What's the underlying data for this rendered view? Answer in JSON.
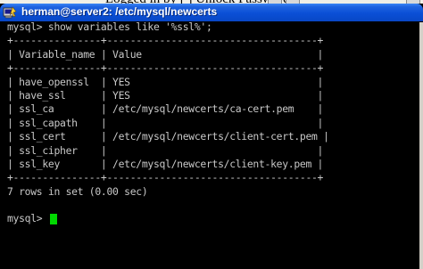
{
  "window": {
    "title": "herman@server2: /etc/mysql/newcerts"
  },
  "top_strip": {
    "partial_text": "Logged in by  [  ]  Unlock  Password"
  },
  "terminal": {
    "lines": [
      "mysql> show variables like '%ssl%';",
      "+---------------+------------------------------------+",
      "| Variable_name | Value                              |",
      "+---------------+------------------------------------+",
      "| have_openssl  | YES                                |",
      "| have_ssl      | YES                                |",
      "| ssl_ca        | /etc/mysql/newcerts/ca-cert.pem    |",
      "| ssl_capath    |                                    |",
      "| ssl_cert      | /etc/mysql/newcerts/client-cert.pem |",
      "| ssl_cipher    |                                    |",
      "| ssl_key       | /etc/mysql/newcerts/client-key.pem |",
      "+---------------+------------------------------------+",
      "7 rows in set (0.00 sec)",
      "",
      "mysql> "
    ],
    "prompt": "mysql> ",
    "cursor_color": "#00d800",
    "text_color": "#c8c8c8",
    "background_color": "#000000"
  },
  "icons": {
    "title": "putty-terminal-icon"
  },
  "colors": {
    "titlebar": "#0a4fd6",
    "title_text": "#ffffff"
  }
}
